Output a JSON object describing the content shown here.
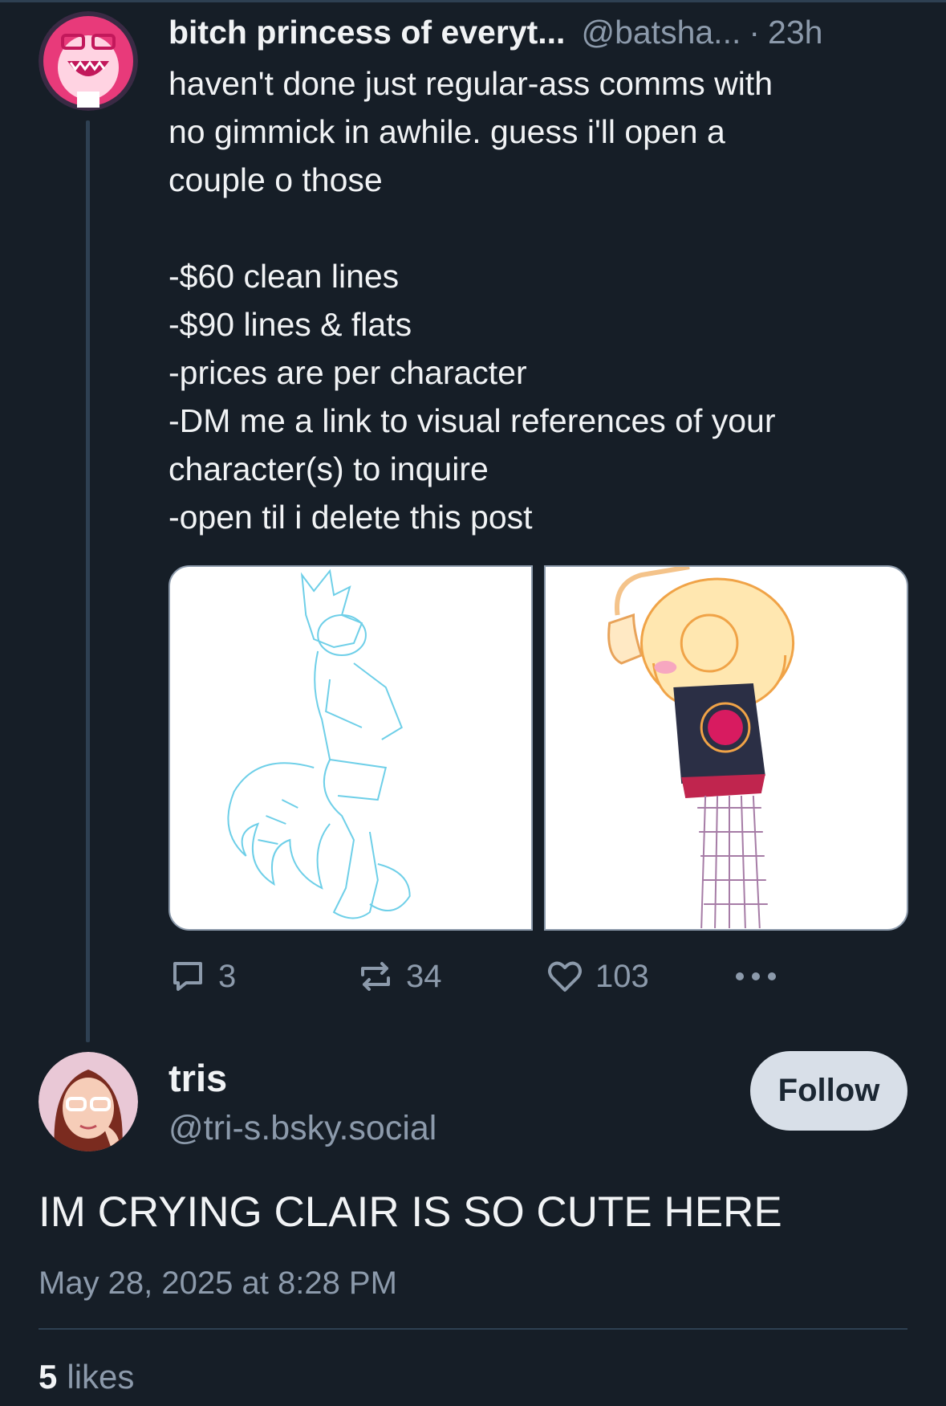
{
  "colors": {
    "background": "#161e27",
    "text_primary": "#f1f3f5",
    "text_secondary": "#8c9aab",
    "thread_line": "#2e4052",
    "follow_button_bg": "#d8dfe8"
  },
  "parent_post": {
    "display_name": "bitch princess of everyt...",
    "handle": "@batsha...",
    "separator": "·",
    "time": "23h",
    "avatar_icon": "avatar-pink-character-icon",
    "text_lines": [
      "haven't done just regular-ass comms with",
      "no gimmick in awhile. guess i'll open a",
      "couple o those",
      "",
      "-$60 clean lines",
      "-$90 lines & flats",
      "-prices are per character",
      "-DM me a link to visual references of your",
      "character(s) to inquire",
      "-open til i delete this post"
    ],
    "media": [
      {
        "icon": "lineart-fox-character-image"
      },
      {
        "icon": "flat-color-character-image"
      }
    ],
    "actions": {
      "reply_count": "3",
      "repost_count": "34",
      "like_count": "103"
    }
  },
  "reply": {
    "display_name": "tris",
    "handle": "@tri-s.bsky.social",
    "follow_label": "Follow",
    "text": "IM CRYING CLAIR IS SO CUTE HERE",
    "date": "May 28, 2025 at 8:28 PM",
    "likes_count": "5",
    "likes_label": "likes"
  }
}
